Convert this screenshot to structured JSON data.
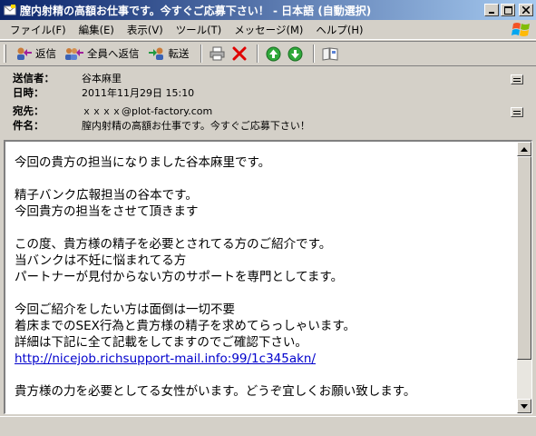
{
  "window": {
    "title": "膣内射精の高額お仕事です。今すぐご応募下さい！ - 日本語 (自動選択)"
  },
  "menu": [
    {
      "label": "ファイル(F)"
    },
    {
      "label": "編集(E)"
    },
    {
      "label": "表示(V)"
    },
    {
      "label": "ツール(T)"
    },
    {
      "label": "メッセージ(M)"
    },
    {
      "label": "ヘルプ(H)"
    }
  ],
  "toolbar": {
    "reply_label": "返信",
    "reply_all_label": "全員へ返信",
    "forward_label": "転送"
  },
  "colors": {
    "title_gradient_start": "#0a246a",
    "title_gradient_end": "#a6caf0",
    "link": "#0000cc",
    "face": "#d4d0c8"
  },
  "header": {
    "from_label": "送信者：",
    "from_value": "谷本麻里",
    "date_label": "日時：",
    "date_value": "2011年11月29日 15:10",
    "to_label": "宛先：",
    "to_value": "ｘｘｘｘ@plot-factory.com",
    "subject_label": "件名：",
    "subject_value": "膣内射精の高額お仕事です。今すぐご応募下さい！"
  },
  "body": {
    "line1": "今回の貴方の担当になりました谷本麻里です。",
    "line2": "精子バンク広報担当の谷本です。",
    "line3": "今回貴方の担当をさせて頂きます",
    "line4": "この度、貴方様の精子を必要とされてる方のご紹介です。",
    "line5": "当バンクは不妊に悩まれてる方",
    "line6": "パートナーが見付からない方のサポートを専門としてます。",
    "line7": "今回ご紹介をしたい方は面倒は一切不要",
    "line8": "着床までのSEX行為と貴方様の精子を求めてらっしゃいます。",
    "line9": "詳細は下記に全て記載をしてますのでご確認下さい。",
    "link": "http://nicejob.richsupport-mail.info:99/1c345akn/",
    "line10": "貴方様の力を必要としてる女性がいます。どうぞ宜しくお願い致します。"
  }
}
